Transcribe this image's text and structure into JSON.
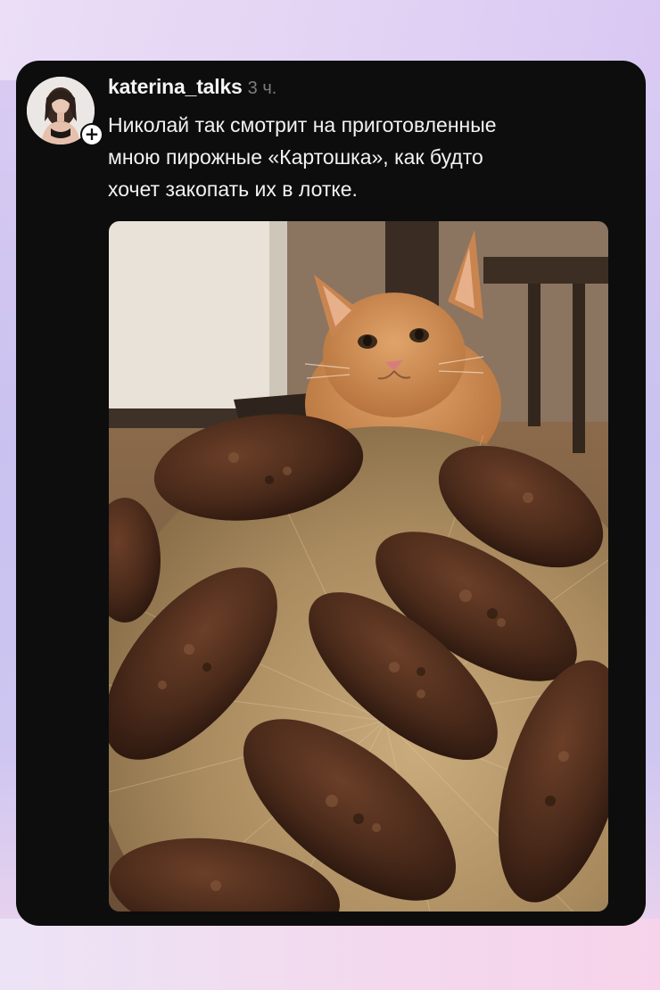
{
  "post": {
    "username": "katerina_talks",
    "timestamp": "3 ч.",
    "text": "Николай так смотрит на приготовленные\nмною пирожные «Картошка», как будто\nхочет закопать их в лотке.",
    "follow_symbol": "+",
    "avatar_icon": "avatar-photo-icon",
    "follow_icon": "plus-icon",
    "photo_subject": "ginger cat looking at plate of chocolate cakes"
  },
  "colors": {
    "card_background": "#0d0d0d",
    "username_color": "#f5f5f5",
    "timestamp_color": "#7c7c7c",
    "page_gradient_top": "#dccdf3",
    "page_gradient_bottom": "#f0d6ec"
  }
}
